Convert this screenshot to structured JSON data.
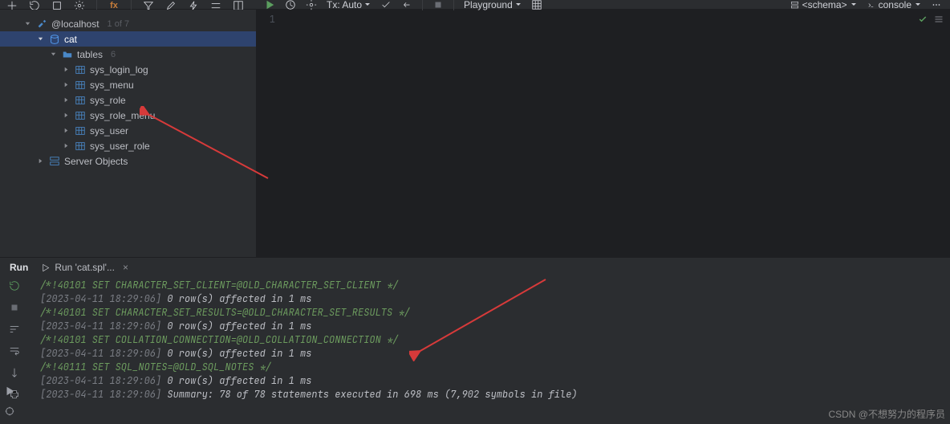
{
  "toolbar_right": {
    "tx": "Tx: Auto",
    "playground": "Playground",
    "schema": "<schema>",
    "console": "console"
  },
  "editor": {
    "line1": "1"
  },
  "tree": {
    "host": {
      "label": "@localhost",
      "meta": "1 of 7"
    },
    "db": {
      "label": "cat"
    },
    "tables_node": {
      "label": "tables",
      "meta": "6"
    },
    "tables": [
      {
        "label": "sys_login_log"
      },
      {
        "label": "sys_menu"
      },
      {
        "label": "sys_role"
      },
      {
        "label": "sys_role_menu"
      },
      {
        "label": "sys_user"
      },
      {
        "label": "sys_user_role"
      }
    ],
    "server_objects": {
      "label": "Server Objects"
    }
  },
  "run": {
    "tab_label": "Run",
    "sub_label": "Run 'cat.spl'..."
  },
  "console": [
    {
      "cls": "c-comment",
      "t": "/*!40101 SET CHARACTER_SET_CLIENT=@OLD_CHARACTER_SET_CLIENT */"
    },
    {
      "cls": "c-msg",
      "ts": "[2023-04-11 18:29:06] ",
      "t": "0 row(s) affected in 1 ms"
    },
    {
      "cls": "c-comment",
      "t": "/*!40101 SET CHARACTER_SET_RESULTS=@OLD_CHARACTER_SET_RESULTS */"
    },
    {
      "cls": "c-msg",
      "ts": "[2023-04-11 18:29:06] ",
      "t": "0 row(s) affected in 1 ms"
    },
    {
      "cls": "c-comment",
      "t": "/*!40101 SET COLLATION_CONNECTION=@OLD_COLLATION_CONNECTION */"
    },
    {
      "cls": "c-msg",
      "ts": "[2023-04-11 18:29:06] ",
      "t": "0 row(s) affected in 1 ms"
    },
    {
      "cls": "c-comment",
      "t": "/*!40111 SET SQL_NOTES=@OLD_SQL_NOTES */"
    },
    {
      "cls": "c-msg",
      "ts": "[2023-04-11 18:29:06] ",
      "t": "0 row(s) affected in 1 ms"
    },
    {
      "cls": "c-msg",
      "ts": "[2023-04-11 18:29:06] ",
      "t": "Summary: 78 of 78 statements executed in 698 ms (7,902 symbols in file)"
    }
  ],
  "watermark": "CSDN @不想努力的程序员"
}
